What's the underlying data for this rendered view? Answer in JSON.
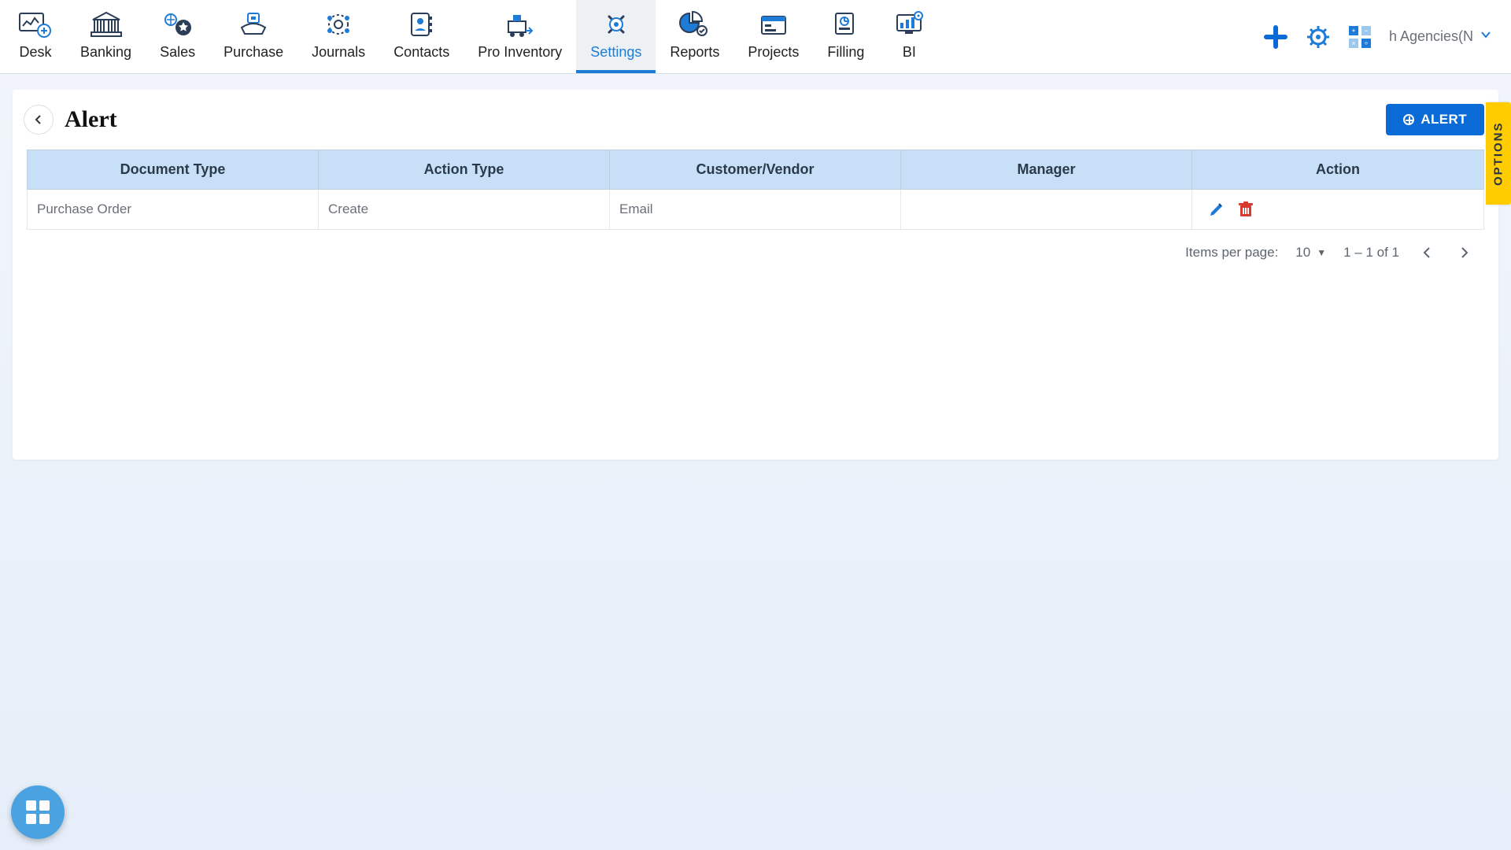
{
  "nav": {
    "tabs": [
      {
        "label": "Desk"
      },
      {
        "label": "Banking"
      },
      {
        "label": "Sales"
      },
      {
        "label": "Purchase"
      },
      {
        "label": "Journals"
      },
      {
        "label": "Contacts"
      },
      {
        "label": "Pro Inventory"
      },
      {
        "label": "Settings"
      },
      {
        "label": "Reports"
      },
      {
        "label": "Projects"
      },
      {
        "label": "Filling"
      },
      {
        "label": "BI"
      }
    ],
    "active_index": 7,
    "org_label": "h Agencies(N"
  },
  "page": {
    "title": "Alert",
    "alert_button": "ALERT"
  },
  "table": {
    "headers": {
      "doc_type": "Document Type",
      "action_type": "Action Type",
      "cust_vendor": "Customer/Vendor",
      "manager": "Manager",
      "action": "Action"
    },
    "rows": [
      {
        "doc_type": "Purchase Order",
        "action_type": "Create",
        "cust_vendor": "Email",
        "manager": ""
      }
    ]
  },
  "paginator": {
    "items_per_page_label": "Items per page:",
    "items_per_page_value": "10",
    "range_label": "1 – 1 of 1"
  },
  "side_tab": "OPTIONS"
}
